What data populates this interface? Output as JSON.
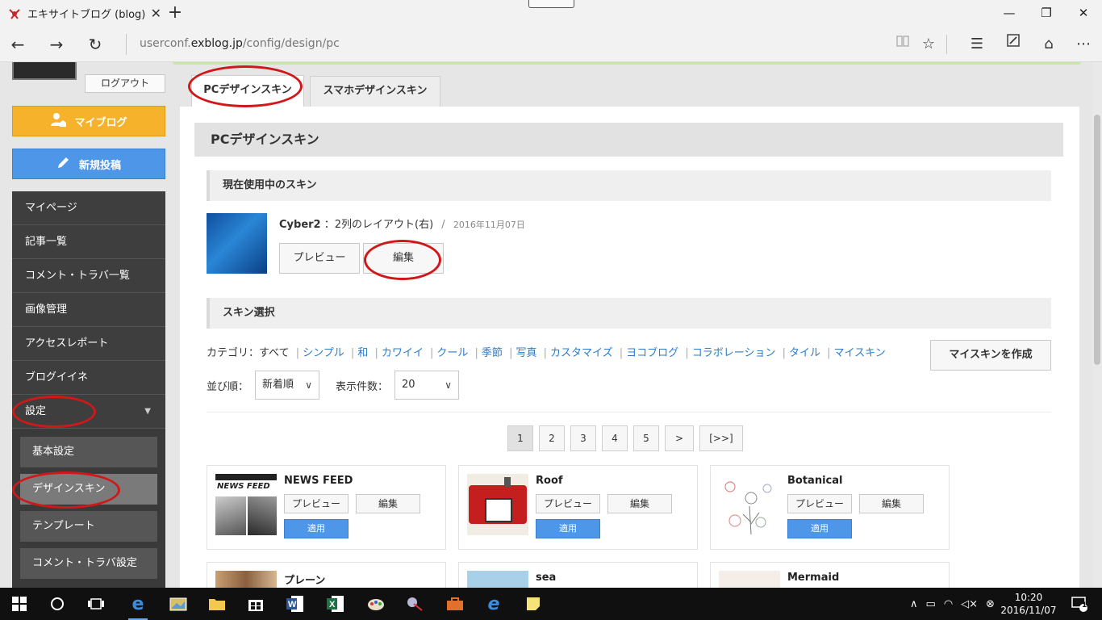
{
  "browser": {
    "tab_title": "エキサイトブログ (blog)|PC:",
    "new_tab": "+",
    "url_prefix": "userconf.",
    "url_domain": "exblog.jp",
    "url_path": "/config/design/pc"
  },
  "sidebar": {
    "logout": "ログアウト",
    "myblog": "マイブログ",
    "newpost": "新規投稿",
    "menu": [
      "マイページ",
      "記事一覧",
      "コメント・トラバ一覧",
      "画像管理",
      "アクセスレポート",
      "ブログイイネ",
      "設定"
    ],
    "submenu": [
      "基本設定",
      "デザインスキン",
      "テンプレート",
      "コメント・トラバ設定"
    ]
  },
  "tabs": {
    "pc": "PCデザインスキン",
    "sp": "スマホデザインスキン"
  },
  "panel": {
    "title": "PCデザインスキン",
    "current_section": "現在使用中のスキン",
    "current_name": "Cyber2",
    "current_layout": "：2列のレイアウト(右)",
    "current_sep": "/",
    "current_date": "2016年11月07日",
    "preview": "プレビュー",
    "edit": "編集",
    "select_section": "スキン選択",
    "category_label": "カテゴリ：",
    "categories": [
      "すべて",
      "シンプル",
      "和",
      "カワイイ",
      "クール",
      "季節",
      "写真",
      "カスタマイズ",
      "ヨコブログ",
      "コラボレーション",
      "タイル",
      "マイスキン"
    ],
    "create_my_skin": "マイスキンを作成",
    "sort_label": "並び順：",
    "sort_value": "新着順",
    "count_label": "表示件数：",
    "count_value": "20",
    "pages": [
      "1",
      "2",
      "3",
      "4",
      "5",
      ">",
      "[>>]"
    ],
    "card_preview": "プレビュー",
    "card_edit": "編集",
    "card_apply": "適用",
    "cards": [
      "NEWS FEED",
      "Roof",
      "Botanical",
      "プレーン",
      "sea",
      "Mermaid"
    ],
    "newsfeed_thumb_text": "NEWS FEED"
  },
  "taskbar": {
    "time": "10:20",
    "date": "2016/11/07",
    "notifications": "1"
  }
}
